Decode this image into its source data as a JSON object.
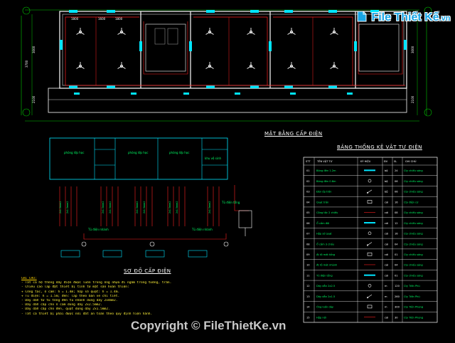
{
  "drawing": {
    "floor_plan_title": "MẶT BẰNG CẤP ĐIỆN",
    "legend_title": "BẢNG THỐNG KÊ VẬT TƯ ĐIỆN",
    "diagram_title": "SƠ ĐỒ CẤP ĐIỆN",
    "room_dims": [
      "1800",
      "1600",
      "1800"
    ],
    "side_dims_left": [
      "3000",
      "3700",
      "2100"
    ],
    "side_dims_right": [
      "3000",
      "2100"
    ],
    "legend_headers": [
      "STT",
      "TÊN VẬT TƯ",
      "KÝ HIỆU",
      "ĐV",
      "SL",
      "GHI CHÚ"
    ],
    "legend_rows": [
      {
        "stt": "01",
        "name": "Bóng đèn 1.2m",
        "unit": "bộ",
        "qty": "24",
        "note": "Cty chiếu sáng"
      },
      {
        "stt": "02",
        "name": "Bóng đèn 0.6m",
        "unit": "bộ",
        "qty": "06",
        "note": "Cty chiếu sáng"
      },
      {
        "stt": "03",
        "name": "Đèn ốp trần",
        "unit": "bộ",
        "qty": "06",
        "note": "Cty chiếu sáng"
      },
      {
        "stt": "04",
        "name": "Quạt trần",
        "unit": "cái",
        "qty": "16",
        "note": "Cty điện cơ"
      },
      {
        "stt": "05",
        "name": "Công tắc 2 chiều",
        "unit": "cái",
        "qty": "08",
        "note": "Cty chiếu sáng"
      },
      {
        "stt": "06",
        "name": "Ổ cắm đôi",
        "unit": "cái",
        "qty": "12",
        "note": "Cty chiếu sáng"
      },
      {
        "stt": "07",
        "name": "Hộp số quạt",
        "unit": "cái",
        "qty": "16",
        "note": "Cty chiếu sáng"
      },
      {
        "stt": "08",
        "name": "Ổ cắm 3 chấu",
        "unit": "cái",
        "qty": "04",
        "note": "Cty chiếu sáng"
      },
      {
        "stt": "09",
        "name": "Át tô mát tổng",
        "unit": "cái",
        "qty": "01",
        "note": "Cty chiếu sáng"
      },
      {
        "stt": "10",
        "name": "Át tô mát nhánh",
        "unit": "cái",
        "qty": "04",
        "note": "Cty chiếu sáng"
      },
      {
        "stt": "11",
        "name": "Tủ điện tổng",
        "unit": "cái",
        "qty": "01",
        "note": "Cty chiếu sáng"
      },
      {
        "stt": "12",
        "name": "Dây dẫn 2x2.5",
        "unit": "m",
        "qty": "120",
        "note": "Cty Trần Phú"
      },
      {
        "stt": "13",
        "name": "Dây dẫn 2x1.5",
        "unit": "m",
        "qty": "260",
        "note": "Cty Trần Phú"
      },
      {
        "stt": "14",
        "name": "Ống luồn dây",
        "unit": "m",
        "qty": "300",
        "note": "Cty Tiền Phong"
      },
      {
        "stt": "15",
        "name": "Hộp nối",
        "unit": "cái",
        "qty": "30",
        "note": "Cty Tiền Phong"
      }
    ],
    "diagram_box_labels": [
      "phòng lớp học",
      "phòng lớp học",
      "phòng lớp học",
      "khu vệ sinh"
    ],
    "diagram_note_labels": [
      "Tủ điện tổng",
      "Tủ điện nhánh",
      "Tủ điện nhánh"
    ],
    "notes": [
      "GHI CHÚ:",
      "- Tất cả hệ thống dây điện được luồn trong ống nhựa đi ngầm trong tường, trần.",
      "- Chiều cao lắp đặt thiết bị tính từ mặt sàn hoàn thiện:",
      "  + Công tắc, ổ cắm: h = 1.4m; hộp số quạt: h = 1.4m.",
      "  + Tủ điện: h = 1.5m; đèn: lắp theo bản vẽ chi tiết.",
      "- Dây dẫn từ tủ tổng đến tủ nhánh dùng dây 2x4mm2.",
      "- Dây dẫn cấp cho ổ cắm dùng dây 2x2.5mm2.",
      "- Dây dẫn cấp cho đèn, quạt dùng dây 2x1.5mm2.",
      "- Tất cả thiết bị phải được nối đất an toàn theo quy định hiện hành."
    ]
  },
  "watermark": {
    "logo_text": "File Thiết Kế",
    "logo_suffix": ".vn",
    "copyright": "Copyright © FileThietKe.vn"
  }
}
